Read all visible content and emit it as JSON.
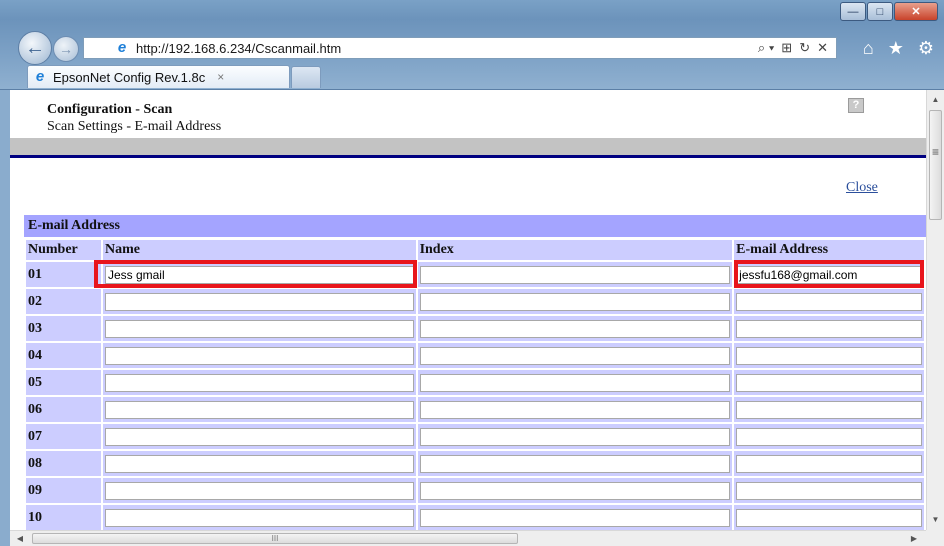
{
  "browser": {
    "url": "http://192.168.6.234/Cscanmail.htm",
    "tab_title": "EpsonNet Config Rev.1.8c",
    "tab_close": "×",
    "window_minimize": "—",
    "window_maximize": "□",
    "window_close": "✕",
    "back_glyph": "←",
    "forward_glyph": "→",
    "address_actions": [
      "⌕ ▾",
      "⊞",
      "↻",
      "✕"
    ],
    "toolbar_icons": [
      "⌂",
      "★",
      "⚙"
    ]
  },
  "page": {
    "title": "Configuration - Scan",
    "subtitle": "Scan Settings - E-mail Address",
    "help_label": "?",
    "close_link": "Close",
    "section_heading": "E-mail Address",
    "columns": [
      "Number",
      "Name",
      "Index",
      "E-mail Address"
    ],
    "rows": [
      {
        "number": "01",
        "name": "Jess gmail",
        "index": "",
        "email": "jessfu168@gmail.com"
      },
      {
        "number": "02",
        "name": "",
        "index": "",
        "email": ""
      },
      {
        "number": "03",
        "name": "",
        "index": "",
        "email": ""
      },
      {
        "number": "04",
        "name": "",
        "index": "",
        "email": ""
      },
      {
        "number": "05",
        "name": "",
        "index": "",
        "email": ""
      },
      {
        "number": "06",
        "name": "",
        "index": "",
        "email": ""
      },
      {
        "number": "07",
        "name": "",
        "index": "",
        "email": ""
      },
      {
        "number": "08",
        "name": "",
        "index": "",
        "email": ""
      },
      {
        "number": "09",
        "name": "",
        "index": "",
        "email": ""
      },
      {
        "number": "10",
        "name": "",
        "index": "",
        "email": ""
      }
    ]
  },
  "scrollbars": {
    "vertical_up": "▲",
    "vertical_down": "▼",
    "vertical_grip": "≡",
    "horizontal_left": "◀",
    "horizontal_right": "▶",
    "horizontal_grip": "III"
  },
  "colors": {
    "header_row": "#cccdff",
    "section_heading": "#a4a4ff",
    "divider": "#000080",
    "highlight": "#e8151c",
    "link": "#2b4f9c"
  }
}
